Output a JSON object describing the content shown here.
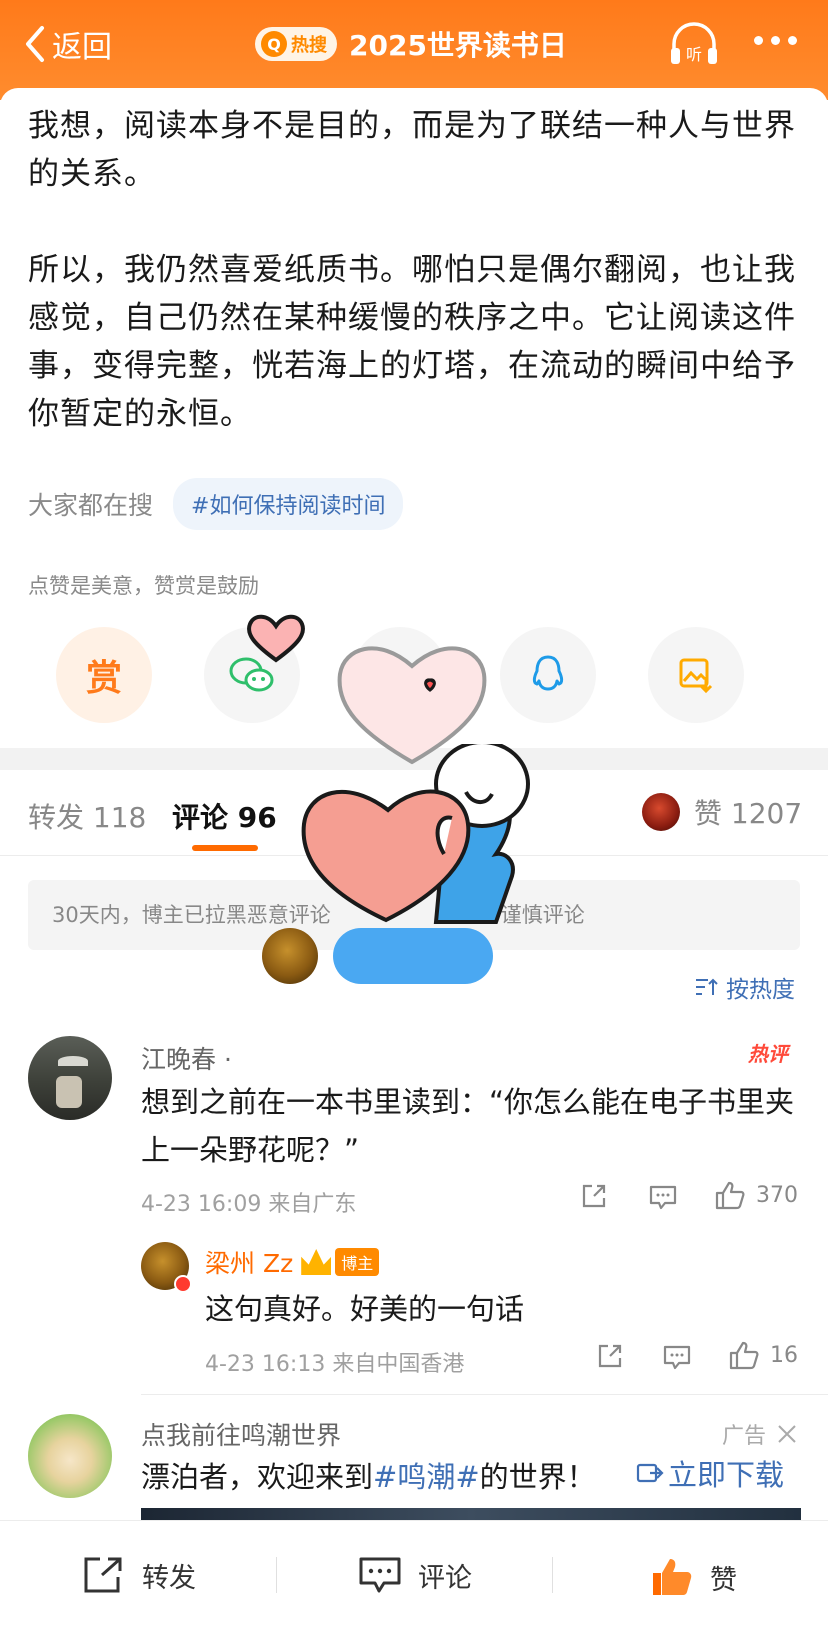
{
  "header": {
    "back_label": "返回",
    "hot_badge": "热搜",
    "title": "2025世界读书日",
    "listen_label": "听"
  },
  "post": {
    "paragraph1": "我想，阅读本身不是目的，而是为了联结一种人与世界的关系。",
    "paragraph2": "所以，我仍然喜爱纸质书。哪怕只是偶尔翻阅，也让我感觉，自己仍然在某种缓慢的秩序之中。它让阅读这件事，变得完整，恍若海上的灯塔，在流动的瞬间中给予你暂定的永恒。",
    "search_label": "大家都在搜",
    "search_tag": "#如何保持阅读时间",
    "encourage": "点赞是美意，赞赏是鼓励",
    "reward_label": "赏"
  },
  "tabs": {
    "repost": "转发 118",
    "comment": "评论 96",
    "like": "赞 1207"
  },
  "notice": "30天内，博主已拉黑恶意评论",
  "notice_tail": "谨慎评论",
  "sort_label": "按热度",
  "comment": {
    "name": "江晚春 ·",
    "hot_tag": "热评",
    "text": "想到之前在一本书里读到：“你怎么能在电子书里夹上一朵野花呢？”",
    "meta": "4-23 16:09  来自广东",
    "likes": "370",
    "reply": {
      "name": "梁州 Zz",
      "badge": "博主",
      "text": "这句真好。好美的一句话",
      "meta": "4-23 16:13  来自中国香港",
      "likes": "16"
    }
  },
  "ad": {
    "title": "点我前往鸣潮世界",
    "flag": "广告",
    "text_pre": "漂泊者，欢迎来到",
    "text_hl": "#鸣潮#",
    "text_post": "的世界！",
    "download": "立即下载"
  },
  "bottom": {
    "repost": "转发",
    "comment": "评论",
    "like": "赞"
  },
  "colors": {
    "brand_orange": "#ff7a1a",
    "link_blue": "#3f6fb5",
    "hot_red": "#ff4a3a"
  }
}
